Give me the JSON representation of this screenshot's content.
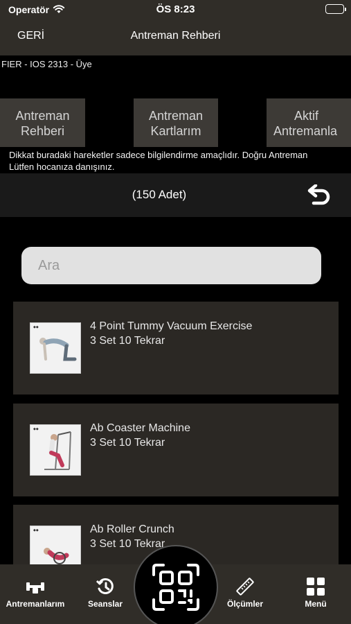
{
  "status": {
    "carrier": "Operatör",
    "time": "ÖS 8:23"
  },
  "nav": {
    "back": "GERİ",
    "title": "Antreman Rehberi"
  },
  "user": {
    "line": "FIER - IOS 2313 - Üye"
  },
  "tabs": [
    {
      "line1": "Antreman",
      "line2": "Rehberi"
    },
    {
      "line1": "Antreman",
      "line2": "Kartlarım"
    },
    {
      "line1": "Aktif",
      "line2": "Antremanla"
    }
  ],
  "notice": "Dikkat buradaki hareketler sadece bilgilendirme amaçlıdır. Doğru Antreman Lütfen hocanıza danışınız.",
  "count": "(150 Adet)",
  "search": {
    "placeholder": "Ara"
  },
  "exercises": [
    {
      "name": "4 Point Tummy Vacuum Exercise",
      "sets": "3 Set 10 Tekrar"
    },
    {
      "name": "Ab Coaster Machine",
      "sets": "3 Set 10 Tekrar"
    },
    {
      "name": "Ab Roller Crunch",
      "sets": "3 Set 10 Tekrar"
    }
  ],
  "tabbar": {
    "workouts": "Antremanlarım",
    "sessions": "Seanslar",
    "measurements": "Ölçümler",
    "menu": "Menü"
  }
}
